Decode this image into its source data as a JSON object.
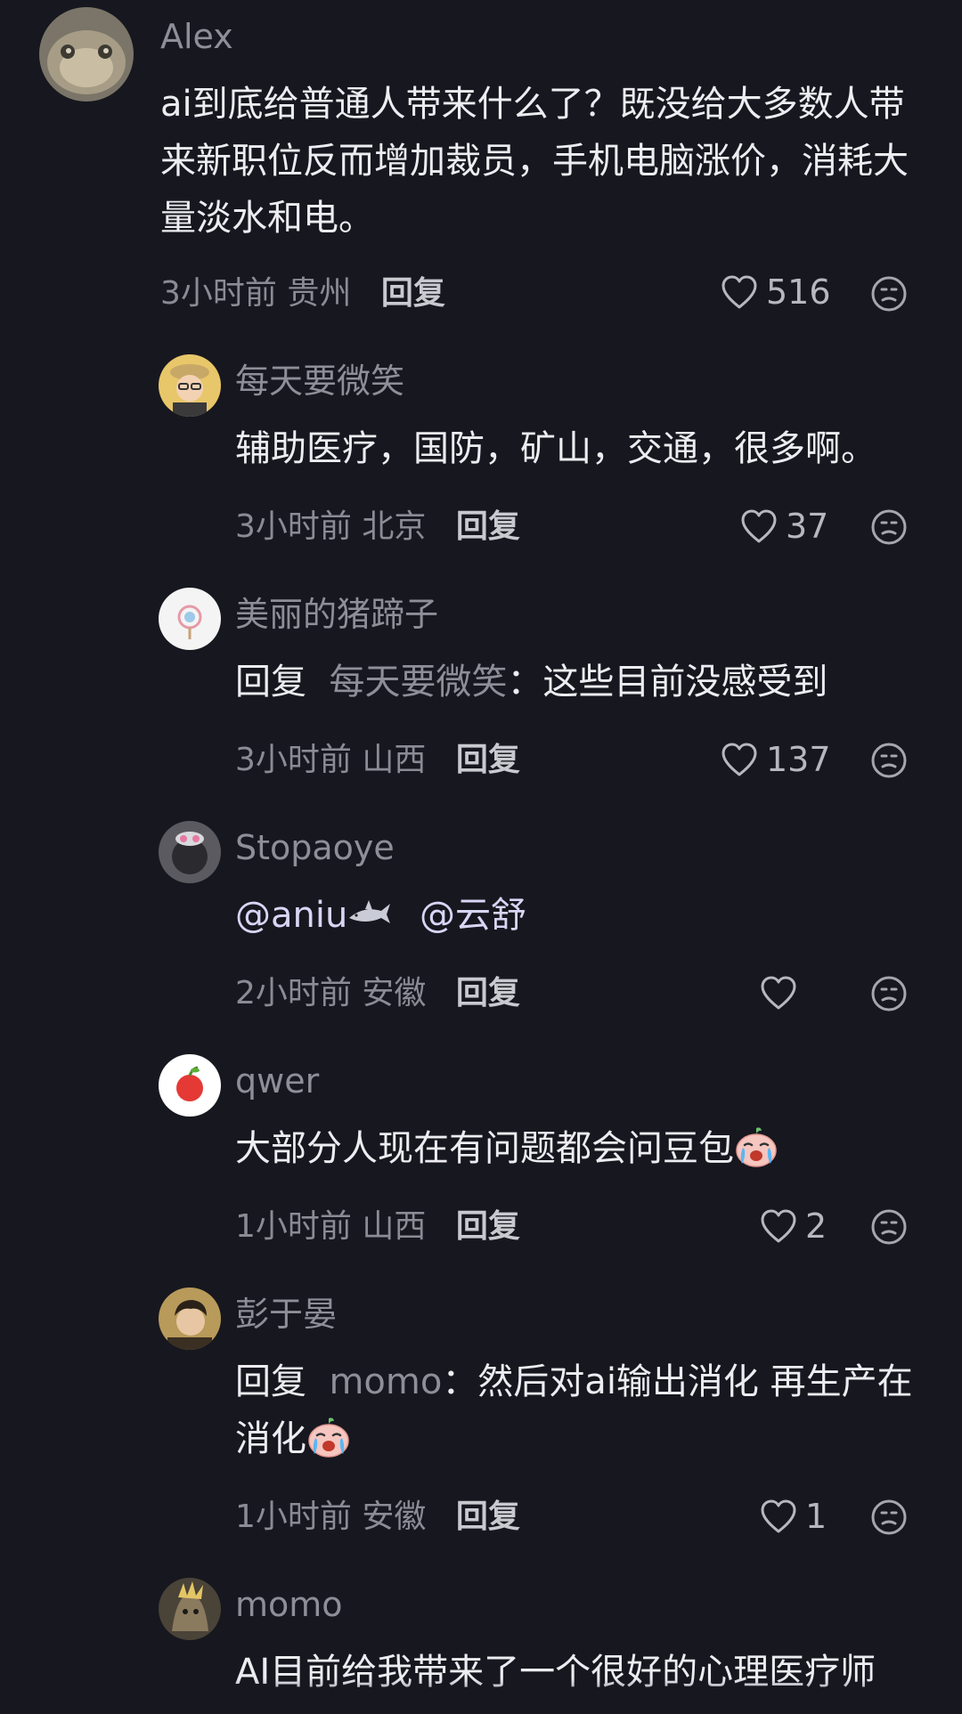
{
  "comments": [
    {
      "user": "Alex",
      "text": "ai到底给普通人带来什么了？既没给大多数人带来新职位反而增加裁员，手机电脑涨价，消耗大量淡水和电。",
      "time": "3小时前",
      "location": "贵州",
      "reply": "回复",
      "likes": "516"
    },
    {
      "user": "每天要微笑",
      "text": "辅助医疗，国防，矿山，交通，很多啊。",
      "time": "3小时前",
      "location": "北京",
      "reply": "回复",
      "likes": "37"
    },
    {
      "user": "美丽的猪蹄子",
      "reply_prefix": "回复",
      "reply_to": "每天要微笑",
      "text": "：这些目前没感受到",
      "time": "3小时前",
      "location": "山西",
      "reply": "回复",
      "likes": "137"
    },
    {
      "user": "Stopaoye",
      "mention1": "@aniu",
      "mention2": "@云舒",
      "time": "2小时前",
      "location": "安徽",
      "reply": "回复",
      "likes": ""
    },
    {
      "user": "qwer",
      "text": "大部分人现在有问题都会问豆包",
      "emoji": "crying-face-emoji",
      "time": "1小时前",
      "location": "山西",
      "reply": "回复",
      "likes": "2"
    },
    {
      "user": "彭于晏",
      "reply_prefix": "回复",
      "reply_to": "momo",
      "text": "：然后对ai输出消化 再生产在消化",
      "emoji": "crying-face-emoji",
      "time": "1小时前",
      "location": "安徽",
      "reply": "回复",
      "likes": "1"
    },
    {
      "user": "momo",
      "text": "AI目前给我带来了一个很好的心理医疗师"
    }
  ],
  "colors": {
    "background": "#17171f",
    "text": "#ececf1",
    "secondary": "#8e8e98"
  },
  "icons": [
    "heart-outline-icon",
    "dislike-face-icon"
  ]
}
